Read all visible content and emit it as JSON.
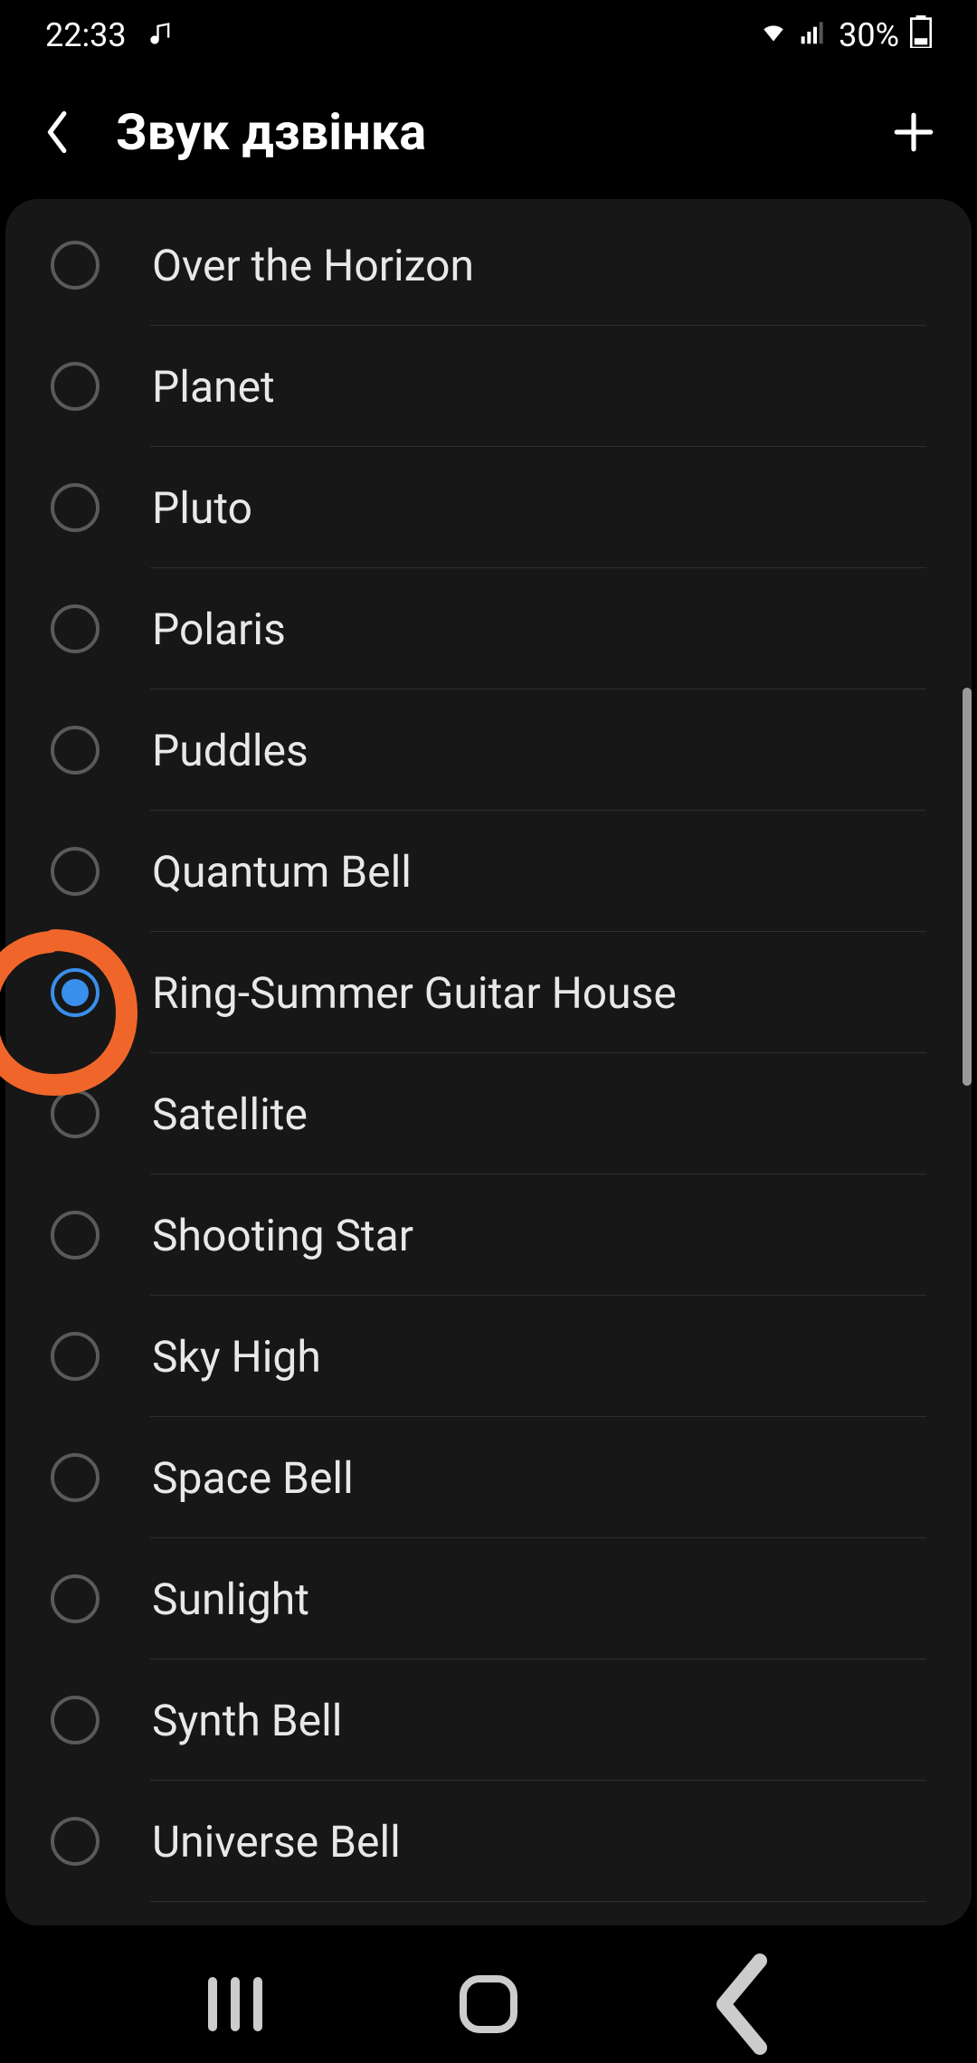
{
  "status": {
    "time": "22:33",
    "battery_percent": "30%"
  },
  "header": {
    "title": "Звук дзвінка"
  },
  "ringtones": [
    {
      "label": "Over the Horizon",
      "selected": false
    },
    {
      "label": "Planet",
      "selected": false
    },
    {
      "label": "Pluto",
      "selected": false
    },
    {
      "label": "Polaris",
      "selected": false
    },
    {
      "label": "Puddles",
      "selected": false
    },
    {
      "label": "Quantum Bell",
      "selected": false
    },
    {
      "label": "Ring-Summer Guitar House",
      "selected": true
    },
    {
      "label": "Satellite",
      "selected": false
    },
    {
      "label": "Shooting Star",
      "selected": false
    },
    {
      "label": "Sky High",
      "selected": false
    },
    {
      "label": "Space Bell",
      "selected": false
    },
    {
      "label": "Sunlight",
      "selected": false
    },
    {
      "label": "Synth Bell",
      "selected": false
    },
    {
      "label": "Universe Bell",
      "selected": false
    }
  ],
  "annotation": {
    "color": "#f0662a"
  }
}
